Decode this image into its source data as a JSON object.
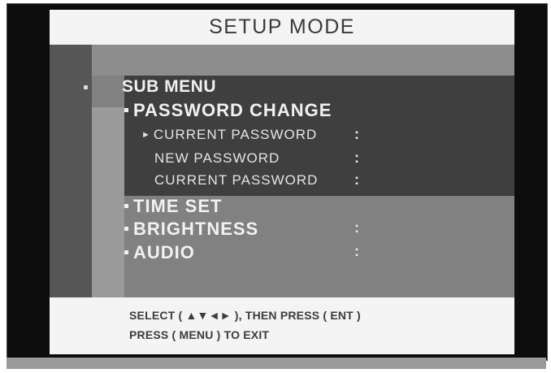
{
  "header": {
    "title": "SETUP MODE"
  },
  "menu": {
    "sub_menu_label": "SUB MENU",
    "password_change": {
      "label": "PASSWORD CHANGE",
      "items": [
        {
          "label": "CURRENT PASSWORD",
          "colon": ":"
        },
        {
          "label": "NEW PASSWORD",
          "colon": ":"
        },
        {
          "label": "CURRENT PASSWORD",
          "colon": ":"
        }
      ]
    },
    "time_set": {
      "label": "TIME SET"
    },
    "brightness": {
      "label": "BRIGHTNESS",
      "colon": ":"
    },
    "audio": {
      "label": "AUDIO",
      "colon": ":"
    }
  },
  "footer": {
    "line1": "SELECT ( ▲▼◄► ), THEN PRESS ( ENT )",
    "line2": "PRESS ( MENU ) TO EXIT"
  },
  "icons": {
    "selection_pointer": "►",
    "bullet": "▪"
  }
}
